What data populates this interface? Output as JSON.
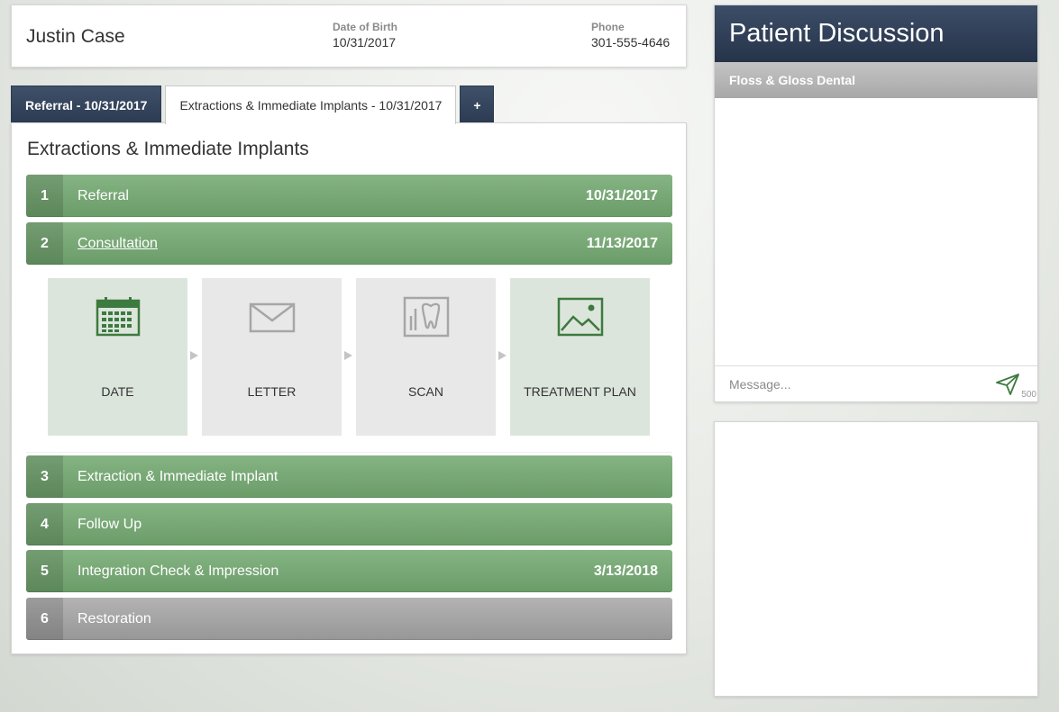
{
  "patient": {
    "name": "Justin Case",
    "dob_label": "Date of Birth",
    "dob_value": "10/31/2017",
    "phone_label": "Phone",
    "phone_value": "301-555-4646"
  },
  "tabs": [
    {
      "label": "Referral - 10/31/2017",
      "active": false
    },
    {
      "label": "Extractions & Immediate Implants - 10/31/2017",
      "active": true
    },
    {
      "label": "+",
      "active": false
    }
  ],
  "main": {
    "title": "Extractions & Immediate Implants",
    "steps": [
      {
        "num": "1",
        "label": "Referral",
        "date": "10/31/2017",
        "status": "complete"
      },
      {
        "num": "2",
        "label": "Consultation",
        "date": "11/13/2017",
        "status": "complete"
      },
      {
        "num": "3",
        "label": "Extraction & Immediate Implant",
        "date": "",
        "status": "complete"
      },
      {
        "num": "4",
        "label": "Follow Up",
        "date": "",
        "status": "complete"
      },
      {
        "num": "5",
        "label": "Integration Check & Impression",
        "date": "3/13/2018",
        "status": "complete"
      },
      {
        "num": "6",
        "label": "Restoration",
        "date": "",
        "status": "pending"
      }
    ],
    "substeps": [
      {
        "label": "DATE",
        "icon": "calendar-icon",
        "status": "done"
      },
      {
        "label": "LETTER",
        "icon": "envelope-icon",
        "status": "pending"
      },
      {
        "label": "SCAN",
        "icon": "tooth-scan-icon",
        "status": "pending"
      },
      {
        "label": "TREATMENT PLAN",
        "icon": "image-icon",
        "status": "done"
      }
    ]
  },
  "discussion": {
    "title": "Patient Discussion",
    "practice": "Floss & Gloss Dental",
    "message_placeholder": "Message...",
    "char_limit": "500"
  },
  "colors": {
    "navy": "#2c3b52",
    "step_green": "#6a9c68",
    "step_gray": "#979797",
    "icon_green": "#3d7a3f",
    "icon_gray": "#a6a6a6"
  }
}
